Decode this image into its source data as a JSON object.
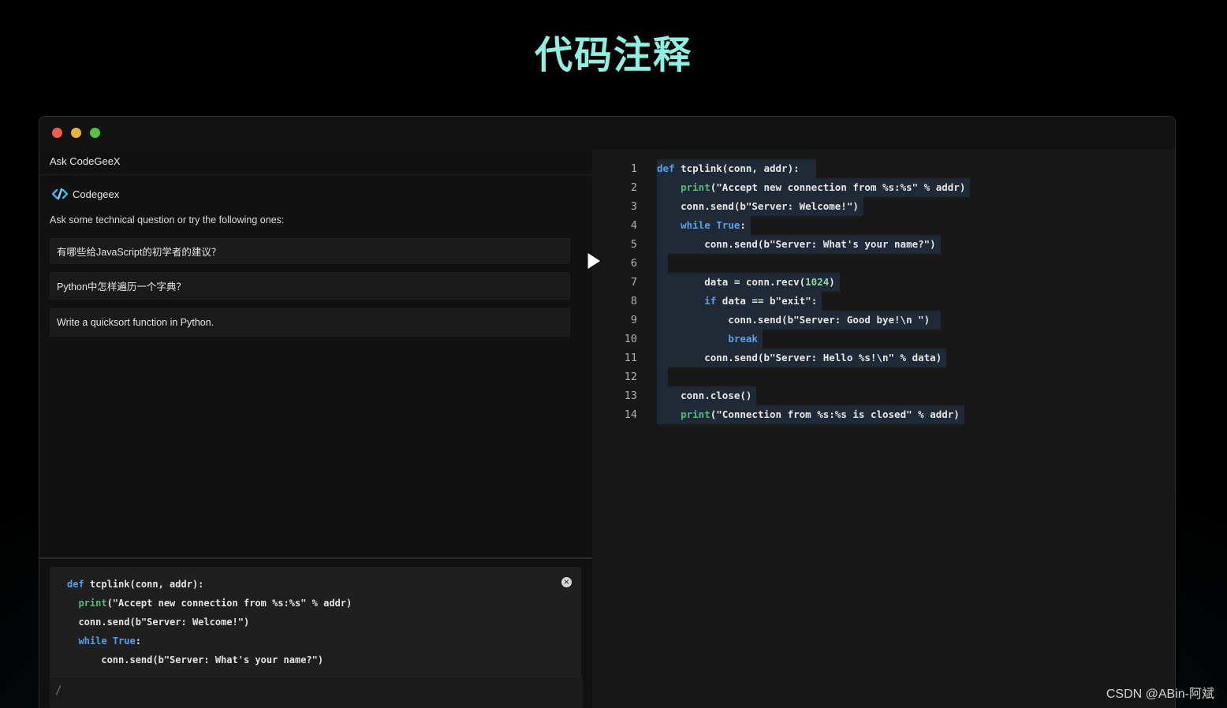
{
  "page_title": "代码注释",
  "left": {
    "header": "Ask CodeGeeX",
    "brand": "Codegeex",
    "intro": "Ask some technical question or try the following ones:",
    "suggestions": [
      "有哪些给JavaScript的初学者的建议？",
      "Python中怎样遍历一个字典？",
      "Write a quicksort function in Python."
    ],
    "snippet_close": "×",
    "snippet_lines": [
      [
        {
          "t": "def",
          "c": "kw"
        },
        {
          "t": " tcplink(conn, addr):"
        }
      ],
      [
        {
          "t": "  "
        },
        {
          "t": "print",
          "c": "fn"
        },
        {
          "t": "(\"Accept new connection from %s:%s\" % addr)"
        }
      ],
      [
        {
          "t": "  conn.send(b\"Server: Welcome!\")"
        }
      ],
      [
        {
          "t": "  "
        },
        {
          "t": "while",
          "c": "kw"
        },
        {
          "t": " "
        },
        {
          "t": "True",
          "c": "kw"
        },
        {
          "t": ":"
        }
      ],
      [
        {
          "t": "      conn.send(b\"Server: What's your name?\")"
        }
      ]
    ],
    "prompt_placeholder": "/"
  },
  "editor": {
    "lines": [
      {
        "n": "1",
        "parts": [
          {
            "t": "def",
            "c": "kw"
          },
          {
            "t": " tcplink(conn, addr):  "
          }
        ]
      },
      {
        "n": "2",
        "parts": [
          {
            "t": "    "
          },
          {
            "t": "print",
            "c": "fn"
          },
          {
            "t": "(\"Accept new connection from %s:%s\" % addr)"
          }
        ]
      },
      {
        "n": "3",
        "parts": [
          {
            "t": "    conn.send(b\"Server: Welcome!\")"
          }
        ]
      },
      {
        "n": "4",
        "parts": [
          {
            "t": "    "
          },
          {
            "t": "while",
            "c": "kw"
          },
          {
            "t": " "
          },
          {
            "t": "True",
            "c": "kw"
          },
          {
            "t": ":"
          }
        ]
      },
      {
        "n": "5",
        "parts": [
          {
            "t": "        conn.send(b\"Server: What's your name?\")"
          }
        ]
      },
      {
        "n": "6",
        "parts": [
          {
            "t": " "
          }
        ]
      },
      {
        "n": "7",
        "parts": [
          {
            "t": "        data = conn.recv("
          },
          {
            "t": "1024",
            "c": "num"
          },
          {
            "t": ")"
          }
        ]
      },
      {
        "n": "8",
        "parts": [
          {
            "t": "        "
          },
          {
            "t": "if",
            "c": "kw"
          },
          {
            "t": " data == b\"exit\":"
          }
        ]
      },
      {
        "n": "9",
        "parts": [
          {
            "t": "            conn.send(b\"Server: Good bye!\\n \") "
          }
        ]
      },
      {
        "n": "10",
        "parts": [
          {
            "t": "            "
          },
          {
            "t": "break",
            "c": "kw"
          }
        ]
      },
      {
        "n": "11",
        "parts": [
          {
            "t": "        conn.send(b\"Server: Hello %s!\\n\" % data)"
          }
        ]
      },
      {
        "n": "12",
        "parts": [
          {
            "t": " "
          }
        ]
      },
      {
        "n": "13",
        "parts": [
          {
            "t": "    conn.close()"
          }
        ]
      },
      {
        "n": "14",
        "parts": [
          {
            "t": "    "
          },
          {
            "t": "print",
            "c": "fn"
          },
          {
            "t": "(\"Connection from %s:%s is closed\" % addr)"
          }
        ]
      }
    ]
  },
  "watermark": "CSDN @ABin-阿斌",
  "colors": {
    "title": "#8ff0e2",
    "keyword": "#5aa0e6",
    "builtin": "#5ab97a",
    "number": "#92d7a5",
    "line_highlight": "#1f2a36"
  }
}
